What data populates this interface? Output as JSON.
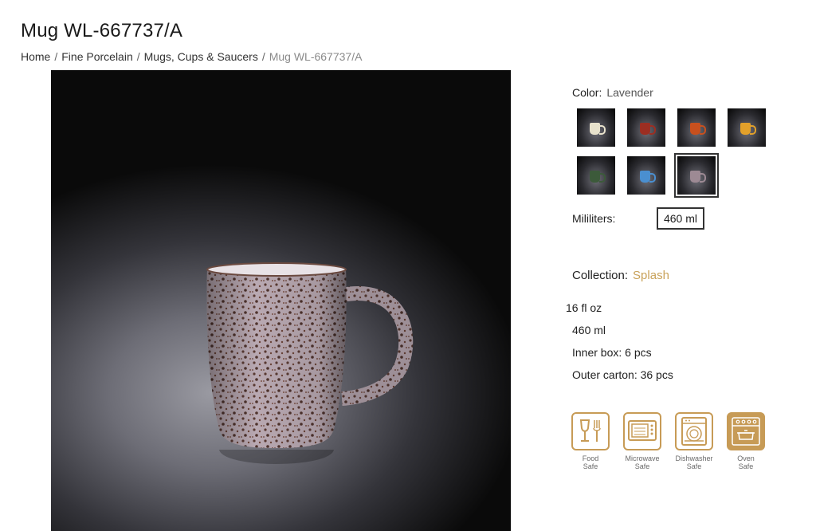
{
  "page": {
    "title": "Mug WL-667737/A"
  },
  "breadcrumb": [
    {
      "label": "Home"
    },
    {
      "label": "Fine Porcelain"
    },
    {
      "label": "Mugs, Cups & Saucers"
    },
    {
      "label": "Mug WL-667737/A"
    }
  ],
  "color": {
    "label": "Color:",
    "value": "Lavender",
    "swatches": [
      {
        "name": "cream",
        "color": "#e8e2cc"
      },
      {
        "name": "red",
        "color": "#9c2e22"
      },
      {
        "name": "orange",
        "color": "#c8501e"
      },
      {
        "name": "yellow",
        "color": "#e2a02a"
      },
      {
        "name": "green",
        "color": "#3c5a3a"
      },
      {
        "name": "blue",
        "color": "#4a8fd0"
      },
      {
        "name": "lavender",
        "color": "#9d8a94",
        "selected": true
      }
    ]
  },
  "volume": {
    "label": "Mililiters:",
    "value": "460 ml"
  },
  "collection": {
    "label": "Collection:",
    "value": "Splash"
  },
  "specs": {
    "fl_oz": "16 fl oz",
    "ml": "460 ml",
    "inner_box": "Inner box: 6 pcs",
    "outer_carton": "Outer carton: 36 pcs"
  },
  "badges": [
    {
      "icon": "food-safe-icon",
      "caption": "Food\nSafe"
    },
    {
      "icon": "microwave-safe-icon",
      "caption": "Microwave\nSafe"
    },
    {
      "icon": "dishwasher-safe-icon",
      "caption": "Dishwasher\nSafe"
    },
    {
      "icon": "oven-safe-icon",
      "caption": "Oven\nSafe"
    }
  ],
  "accent": "#c79b56"
}
